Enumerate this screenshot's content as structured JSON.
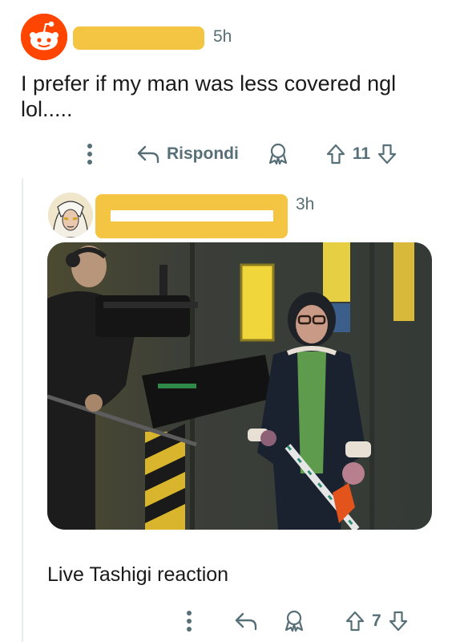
{
  "comment1": {
    "time": "5h",
    "body_line1": "I prefer if my man was less covered ngl",
    "body_line2": "lol.....",
    "reply_label": "Rispondi",
    "vote_count": "11"
  },
  "comment2": {
    "time": "3h",
    "caption": "Live Tashigi reaction",
    "vote_count": "7"
  },
  "colors": {
    "reddit_orange": "#ff4500",
    "redaction_yellow": "#f4c542",
    "meta_gray": "#576f76"
  },
  "icons": [
    "reddit-snoo-avatar-icon",
    "more-vertical-icon",
    "reply-arrow-icon",
    "award-icon",
    "upvote-arrow-icon",
    "downvote-arrow-icon",
    "user-avatar-icon"
  ]
}
